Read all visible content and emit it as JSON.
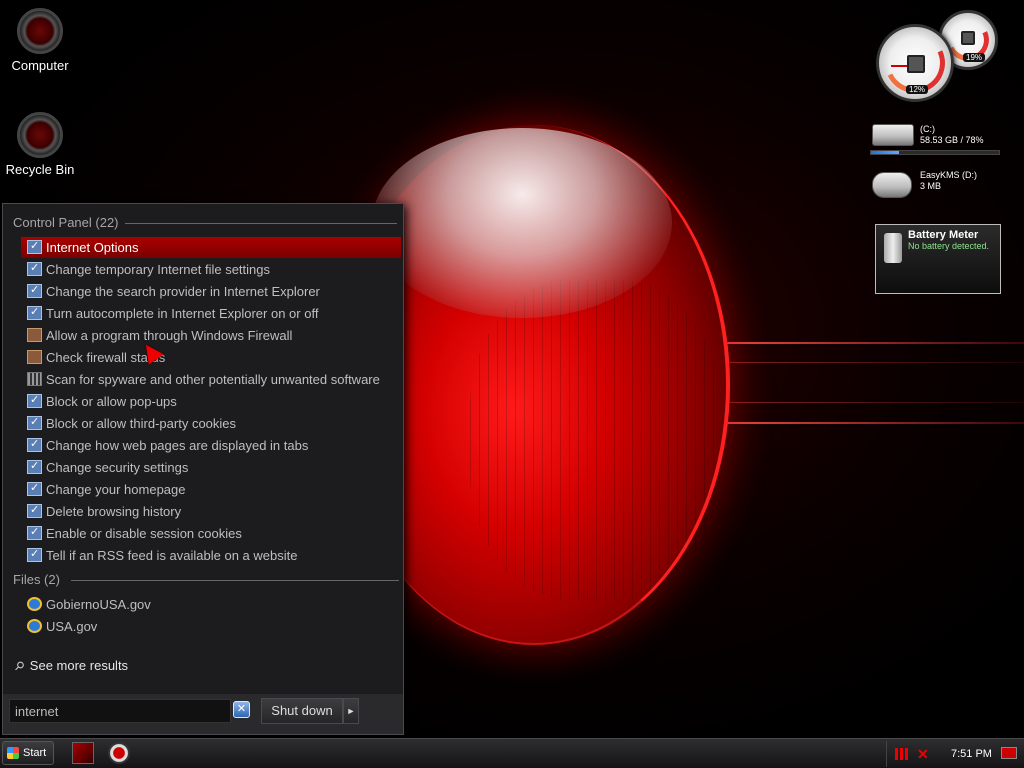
{
  "desktop": {
    "icons": [
      {
        "label": "Computer"
      },
      {
        "label": "Recycle Bin"
      }
    ]
  },
  "gadgets": {
    "cpu_meter": {
      "cpu_percent": "12%",
      "memory_percent": "19%"
    },
    "drives": [
      {
        "name": "(C:)",
        "info": "58.53 GB / 78%",
        "fill_fraction": 0.22
      },
      {
        "name": "EasyKMS (D:)",
        "info": "3 MB"
      }
    ],
    "battery": {
      "title": "Battery Meter",
      "status": "No battery detected."
    }
  },
  "start_menu": {
    "groups": [
      {
        "header": "Control Panel (22)",
        "items": [
          {
            "label": "Internet Options",
            "icon": "control-panel-icon",
            "selected": true
          },
          {
            "label": "Change temporary Internet file settings",
            "icon": "control-panel-icon"
          },
          {
            "label": "Change the search provider in Internet Explorer",
            "icon": "control-panel-icon"
          },
          {
            "label": "Turn autocomplete in Internet Explorer on or off",
            "icon": "control-panel-icon"
          },
          {
            "label": "Allow a program through Windows Firewall",
            "icon": "firewall-icon"
          },
          {
            "label": "Check firewall status",
            "icon": "firewall-icon"
          },
          {
            "label": "Scan for spyware and other potentially unwanted software",
            "icon": "defender-icon"
          },
          {
            "label": "Block or allow pop-ups",
            "icon": "control-panel-icon"
          },
          {
            "label": "Block or allow third-party cookies",
            "icon": "control-panel-icon"
          },
          {
            "label": "Change how web pages are displayed in tabs",
            "icon": "control-panel-icon"
          },
          {
            "label": "Change security settings",
            "icon": "control-panel-icon"
          },
          {
            "label": "Change your homepage",
            "icon": "control-panel-icon"
          },
          {
            "label": "Delete browsing history",
            "icon": "control-panel-icon"
          },
          {
            "label": "Enable or disable session cookies",
            "icon": "control-panel-icon"
          },
          {
            "label": "Tell if an RSS feed is available on a website",
            "icon": "control-panel-icon"
          }
        ]
      },
      {
        "header": "Files (2)",
        "items": [
          {
            "label": "GobiernoUSA.gov",
            "icon": "internet-explorer-icon"
          },
          {
            "label": "USA.gov",
            "icon": "internet-explorer-icon"
          }
        ]
      }
    ],
    "see_more": "See more results",
    "search_value": "internet",
    "shutdown_label": "Shut down",
    "shutdown_arrow": "►",
    "clear_glyph": "✕"
  },
  "taskbar": {
    "start_label": "Start",
    "clock": "7:51 PM"
  },
  "colors": {
    "accent": "#a00000",
    "wallpaper_red": "#d30000"
  }
}
